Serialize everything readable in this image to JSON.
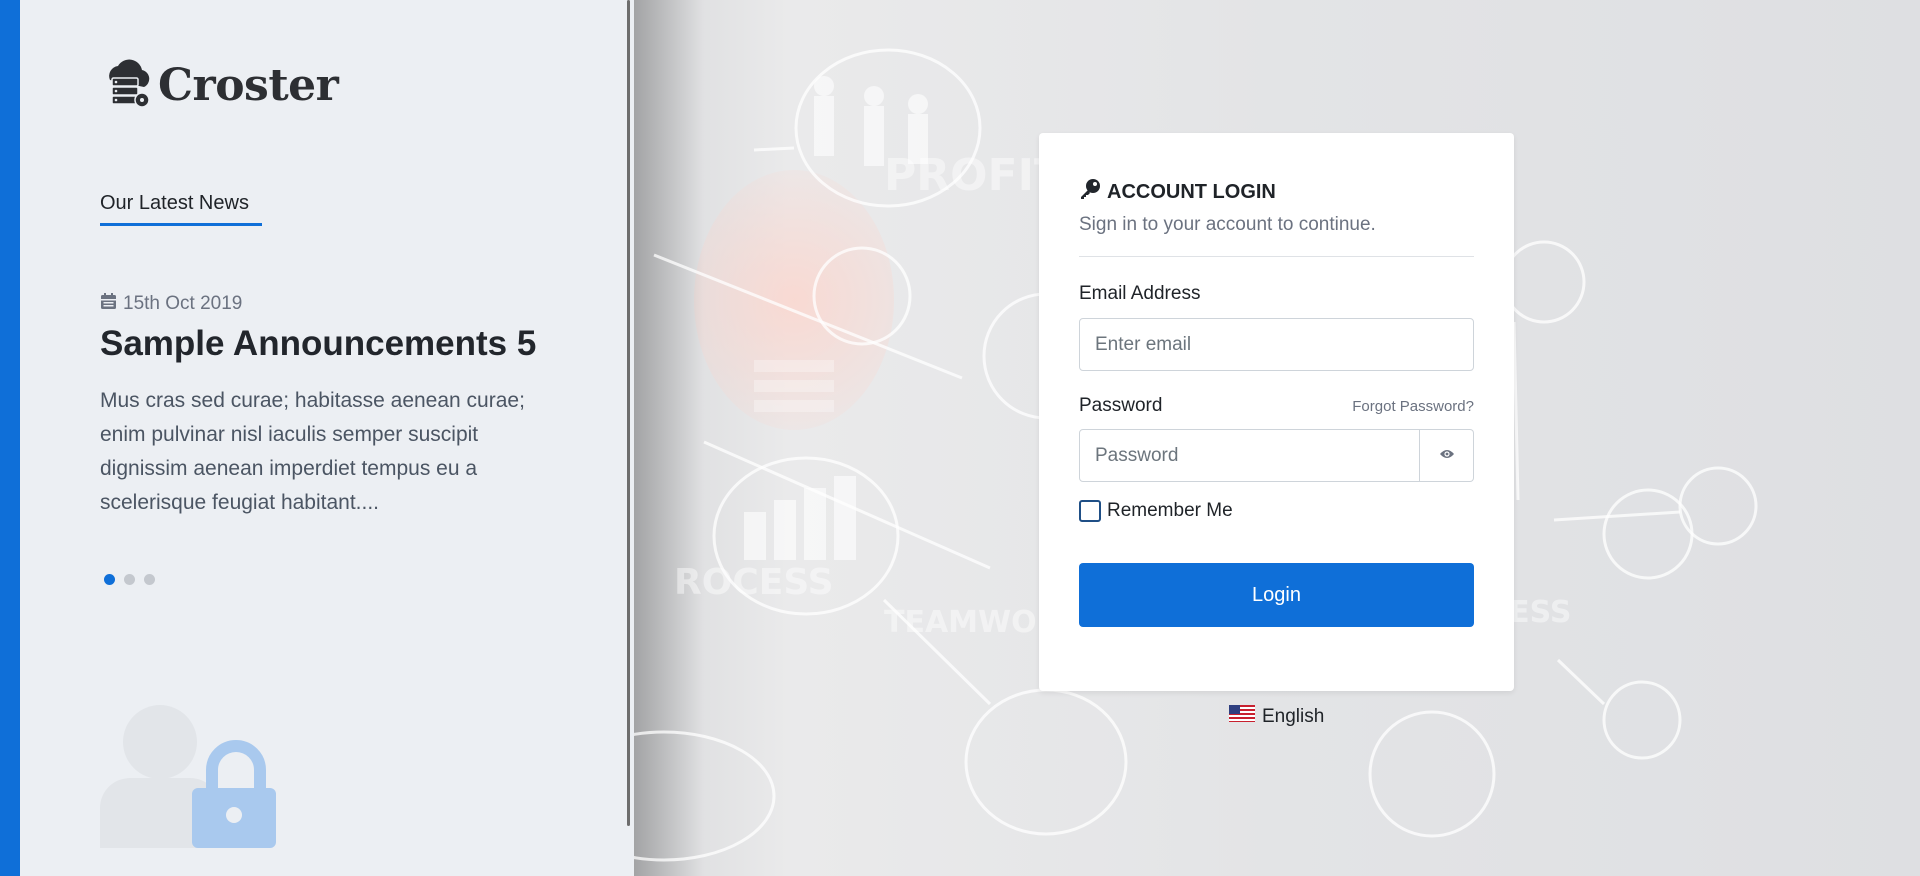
{
  "brand": {
    "name": "Croster"
  },
  "news": {
    "heading": "Our Latest News",
    "date": "15th Oct 2019",
    "title": "Sample Announcements 5",
    "body": "Mus cras sed curae; habitasse aenean curae; enim pulvinar nisl iaculis semper suscipit dignissim aenean imperdiet tempus eu a scelerisque feugiat habitant....",
    "slide_count": 3,
    "active_slide": 1
  },
  "login": {
    "title": "ACCOUNT LOGIN",
    "subtitle": "Sign in to your account to continue.",
    "email_label": "Email Address",
    "email_placeholder": "Enter email",
    "password_label": "Password",
    "forgot_label": "Forgot Password?",
    "password_placeholder": "Password",
    "remember_label": "Remember Me",
    "remember_checked": false,
    "button_label": "Login"
  },
  "language": {
    "label": "English",
    "flag": "us-flag-icon"
  },
  "colors": {
    "accent": "#0f6fd8",
    "panel": "#eceff3",
    "lock": "#a9c9ee"
  }
}
